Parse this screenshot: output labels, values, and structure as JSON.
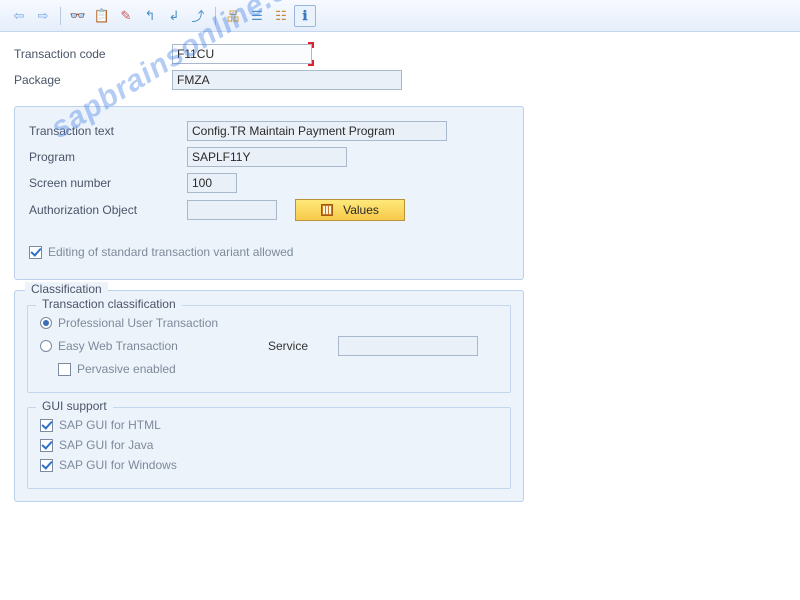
{
  "watermark": "sapbrainsonline.com",
  "toolbar": {
    "back": "⇦",
    "forward": "⇨",
    "glasses": "👓",
    "clipboard": "📋",
    "pencil": "✎",
    "corner1": "↰",
    "corner2": "↲",
    "export": "⤴",
    "tree": "品",
    "align": "☰",
    "list": "☷",
    "info": "ℹ"
  },
  "header": {
    "tcode_label": "Transaction code",
    "tcode_value": "F11CU",
    "package_label": "Package",
    "package_value": "FMZA"
  },
  "details": {
    "text_label": "Transaction text",
    "text_value": "Config.TR Maintain Payment Program",
    "program_label": "Program",
    "program_value": "SAPLF11Y",
    "screen_label": "Screen number",
    "screen_value": "100",
    "auth_label": "Authorization Object",
    "auth_value": "",
    "values_btn": "Values",
    "edit_variant_label": "Editing of standard transaction variant allowed",
    "edit_variant_checked": true
  },
  "classification": {
    "title": "Classification",
    "trans_class_title": "Transaction classification",
    "prof_user": "Professional User Transaction",
    "easy_web": "Easy Web Transaction",
    "service_label": "Service",
    "service_value": "",
    "pervasive": "Pervasive enabled",
    "gui_title": "GUI support",
    "gui_html": "SAP GUI for HTML",
    "gui_java": "SAP GUI for Java",
    "gui_windows": "SAP GUI for Windows"
  }
}
